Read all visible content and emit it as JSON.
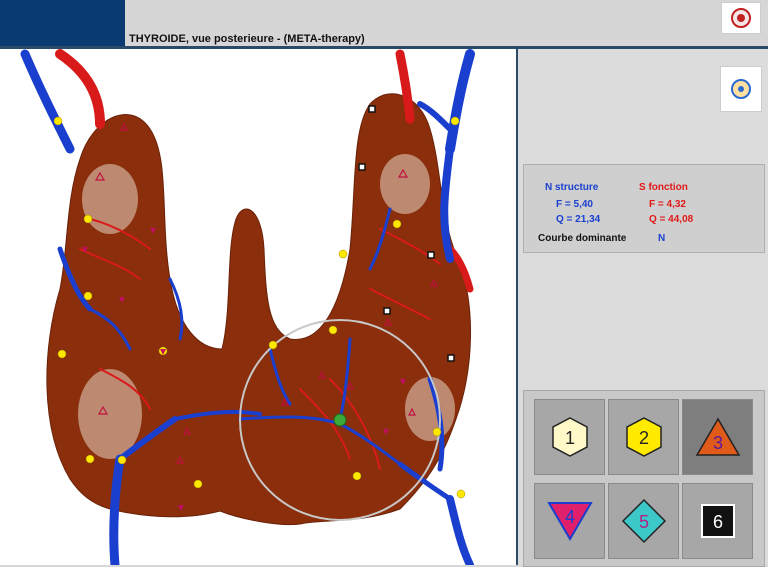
{
  "header": {
    "title": "THYROIDE, vue posterieure - (META-therapy)"
  },
  "info": {
    "n_structure_label": "N structure",
    "s_fonction_label": "S fonction",
    "n_f": "F =  5,40",
    "n_q": "Q = 21,34",
    "s_f": "F =  4,32",
    "s_q": "Q = 44,08",
    "dominant_label": "Courbe dominante",
    "dominant_value": "N"
  },
  "buttons": [
    {
      "label": "1",
      "shape": "hexagon",
      "color": "#fff8c8"
    },
    {
      "label": "2",
      "shape": "hexagon",
      "color": "#ffea00"
    },
    {
      "label": "3",
      "shape": "triangle-up",
      "color": "#e05a1a"
    },
    {
      "label": "4",
      "shape": "triangle-down",
      "color": "#e0206a"
    },
    {
      "label": "5",
      "shape": "diamond",
      "color": "#3cc8c8"
    },
    {
      "label": "6",
      "shape": "square",
      "color": "#111111"
    }
  ],
  "colors": {
    "accent": "#0a3a72",
    "structure": "#1a3fcf",
    "fonction": "#e01818",
    "tissue": "#8a2e0c"
  },
  "icons": [
    "app-logo-icon",
    "session-icon",
    "green-target-icon"
  ]
}
